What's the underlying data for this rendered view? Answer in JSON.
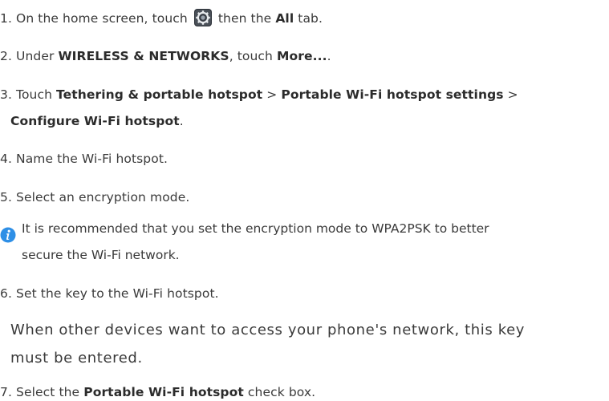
{
  "steps": {
    "s1": {
      "a": "1. On the home screen, touch ",
      "b": " then the ",
      "c": "All",
      "d": " tab."
    },
    "s2": {
      "a": "2. Under ",
      "b": "WIRELESS & NETWORKS",
      "c": ", touch ",
      "d": "More...",
      "e": "."
    },
    "s3": {
      "a": "3. Touch ",
      "b": "Tethering & portable hotspot",
      "c": " > ",
      "d": "Portable Wi-Fi hotspot settings",
      "e": " >",
      "f": "Configure Wi-Fi hotspot",
      "g": "."
    },
    "s4": {
      "a": "4. Name the Wi-Fi hotspot."
    },
    "s5": {
      "a": "5. Select an encryption mode."
    },
    "s6": {
      "a": "6. Set the key to the Wi-Fi hotspot."
    },
    "s7": {
      "a": "7. Select the ",
      "b": "Portable Wi-Fi hotspot",
      "c": " check box."
    }
  },
  "note": {
    "line1": "It is recommended that you set the encryption mode to WPA2PSK to better",
    "line2": "secure the Wi-Fi network."
  },
  "paragraph": {
    "line1": "When other devices want to access your phone's network, this key",
    "line2": "must be entered."
  },
  "icons": {
    "settings": "settings-gear-icon",
    "note": "info-icon"
  },
  "colors": {
    "note_icon_blue": "#2e8fe6",
    "settings_icon_dark": "#3a3f47"
  }
}
